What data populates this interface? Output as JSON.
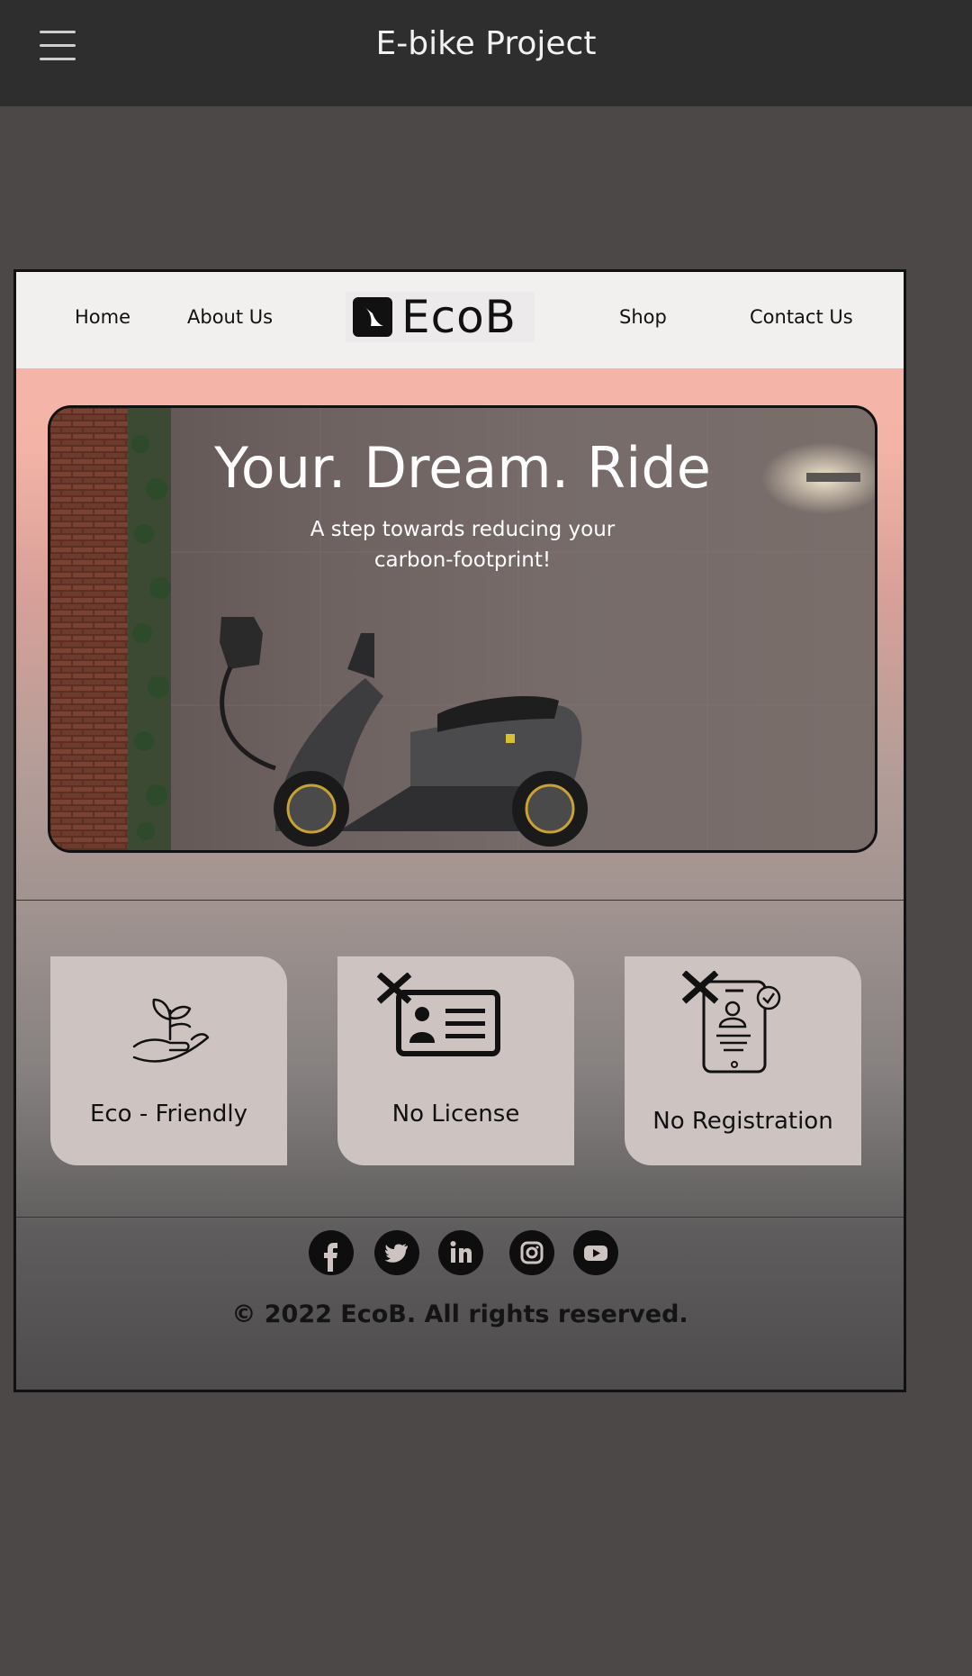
{
  "app": {
    "title": "E-bike Project"
  },
  "nav": {
    "home": "Home",
    "about": "About Us",
    "logo_text": "EcoB",
    "shop": "Shop",
    "contact": "Contact Us"
  },
  "hero": {
    "title": "Your. Dream. Ride",
    "subtitle_line1": "A step towards reducing your",
    "subtitle_line2": "carbon-footprint!"
  },
  "features": [
    {
      "label": "Eco - Friendly",
      "icon": "plant-in-hand-icon"
    },
    {
      "label": "No License",
      "icon": "id-card-icon"
    },
    {
      "label": "No Registration",
      "icon": "phone-registration-icon"
    }
  ],
  "footer": {
    "social": [
      "facebook-icon",
      "twitter-icon",
      "linkedin-icon",
      "instagram-icon",
      "youtube-icon"
    ],
    "copyright": "© 2022 EcoB. All rights reserved."
  }
}
